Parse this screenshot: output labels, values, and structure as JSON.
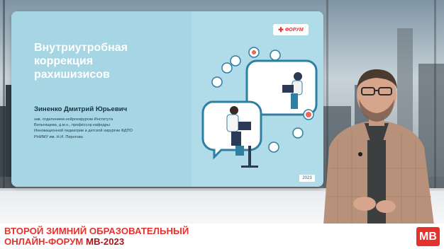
{
  "slide": {
    "title_lines": [
      "Внутриутробная",
      "коррекция",
      "рахишизисов"
    ],
    "speaker_name": "Зиненко Дмитрий Юрьевич",
    "speaker_desc_lines": [
      "зав. отделением нейрохирургии Института",
      "Вельтищева, д.м.н., профессор кафедры",
      "Инновационной педиатрии и детской хирургии ФДПО",
      "РНИМУ им. Н.И. Пирогова"
    ],
    "logo_text": "ФОРУМ",
    "logo_cross": "✚",
    "year": "2023"
  },
  "lower_third": {
    "line1": "ВТОРОЙ ЗИМНИЙ ОБРАЗОВАТЕЛЬНЫЙ",
    "line2_prefix": "ОНЛАЙН-ФОРУМ",
    "line2_strong": "МВ-2023",
    "badge": "МВ"
  },
  "colors": {
    "accent": "#e5322d",
    "slide_bg": "#a8d6e4",
    "speaker_text": "#143446"
  }
}
